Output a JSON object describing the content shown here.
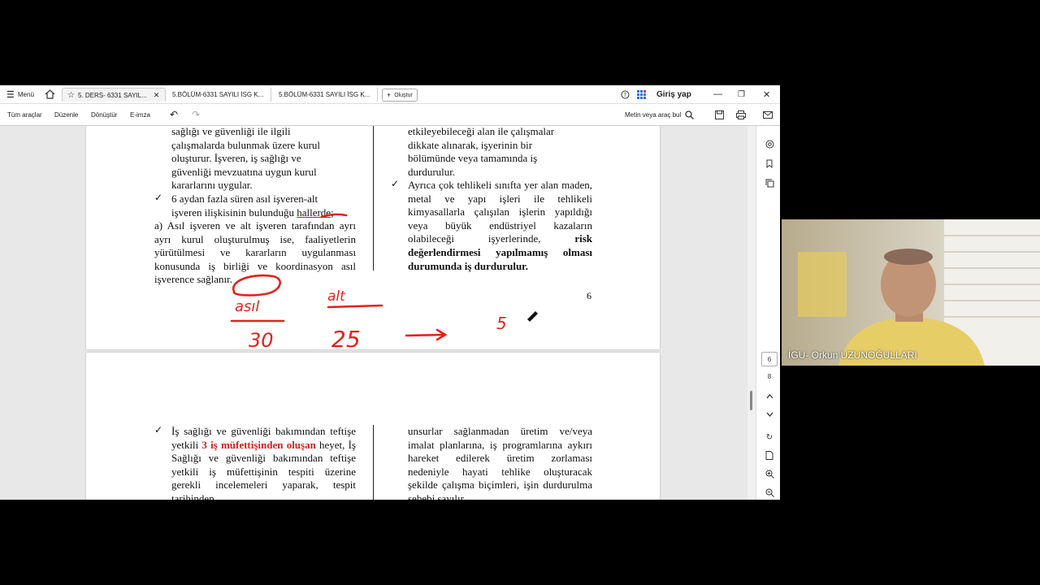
{
  "tabbar": {
    "menu_label": "Menü",
    "tabs": [
      {
        "label": "5. DERS- 6331 SAYIL...",
        "active": true
      },
      {
        "label": "5.BÖLÜM-6331 SAYILI İSG K...",
        "active": false
      },
      {
        "label": "5.BÖLÜM-6331 SAYILI İSG K...",
        "active": false
      }
    ],
    "new_tab_label": "Oluştur",
    "login_label": "Giriş yap"
  },
  "toolbar": {
    "items": [
      "Tüm araçlar",
      "Düzenle",
      "Dönüştür",
      "E-imza"
    ],
    "search_label": "Metin veya araç bul"
  },
  "document": {
    "page1": {
      "left_lines": [
        "sağlığı ve güvenliği ile ilgili",
        "çalışmalarda bulunmak üzere kurul",
        "oluşturur. İşveren, iş sağlığı ve",
        "güvenliği mevzuatına uygun kurul",
        "kararlarını uygular."
      ],
      "left_bullet_1": "6 aydan fazla süren asıl işveren-alt",
      "left_bullet_2a": "işveren ilişkisinin bulunduğu ",
      "left_bullet_2b": "hallerde",
      "left_bullet_2c": ";",
      "left_para": "a) Asıl işveren ve alt işveren tarafından ayrı ayrı kurul oluşturulmuş ise, faaliyetlerin yürütülmesi ve kararların uygulanması konusunda iş birliği ve koordinasyon asıl işverence sağlanır.",
      "right_lines": [
        "etkileyebileceği alan ile çalışmalar",
        "dikkate alınarak, işyerinin bir",
        "bölümünde veya tamamında iş",
        "durdurulur."
      ],
      "right_bullet_normal": "Ayrıca çok tehlikeli sınıfta yer alan maden, metal ve yapı işleri ile tehlikeli kimyasallarla çalışılan işlerin yapıldığı veya büyük endüstriyel kazaların olabileceği işyerlerinde, ",
      "right_bullet_bold": "risk değerlendirmesi yapılmamış olması durumunda iş durdurulur.",
      "page_number": "6",
      "annotations": {
        "asil": "asıl",
        "alt": "alt",
        "n1": "30",
        "n2": "25",
        "n3": "5"
      }
    },
    "page2": {
      "left_pre": "İş sağlığı ve güvenliği bakımından teftişe yetkili ",
      "left_red": "3 iş müfettişinden oluşan",
      "left_post": " heyet, İş Sağlığı ve güvenliği bakımından teftişe yetkili iş müfettişinin tespiti üzerine gerekli incelemeleri yaparak, tespit tarihinden",
      "right_text": "unsurlar sağlanmadan üretim ve/veya imalat planlarına, iş programlarına aykırı hareket edilerek üretim zorlaması nedeniyle hayati tehlike oluşturacak şekilde çalışma biçimleri, işin durdurulma sebebi sayılır."
    }
  },
  "rail": {
    "page_current": "6",
    "page_total": "8"
  },
  "webcam": {
    "name": "İGU- Orkun UZUNOĞULLARI"
  },
  "colors": {
    "accent_red": "#d0201a",
    "ink_red": "#e0231b"
  }
}
